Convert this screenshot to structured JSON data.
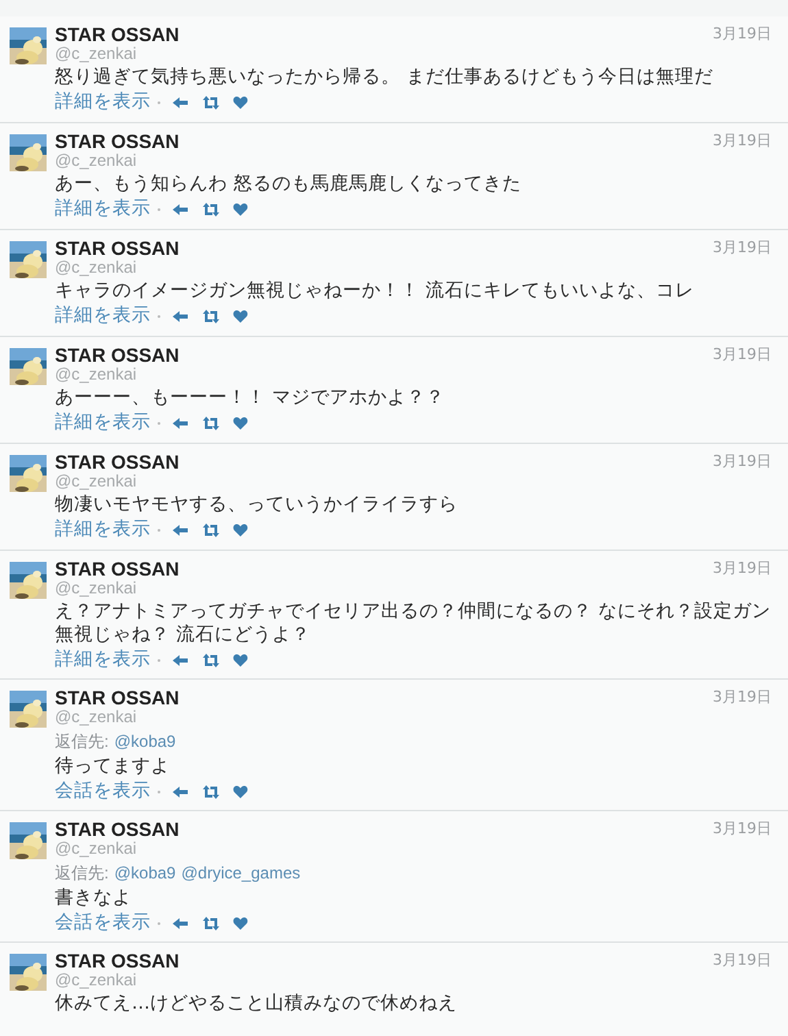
{
  "tweets": [
    {
      "name": "STAR OSSAN",
      "handle": "@c_zenkai",
      "date": "3月19日",
      "text": "怒り過ぎて気持ち悪いなったから帰る。 まだ仕事あるけどもう今日は無理だ",
      "link": "詳細を表示"
    },
    {
      "name": "STAR OSSAN",
      "handle": "@c_zenkai",
      "date": "3月19日",
      "text": "あー、もう知らんわ 怒るのも馬鹿馬鹿しくなってきた",
      "link": "詳細を表示"
    },
    {
      "name": "STAR OSSAN",
      "handle": "@c_zenkai",
      "date": "3月19日",
      "text": "キャラのイメージガン無視じゃねーか！！ 流石にキレてもいいよな、コレ",
      "link": "詳細を表示"
    },
    {
      "name": "STAR OSSAN",
      "handle": "@c_zenkai",
      "date": "3月19日",
      "text": "あーーー、もーーー！！ マジでアホかよ？？",
      "link": "詳細を表示"
    },
    {
      "name": "STAR OSSAN",
      "handle": "@c_zenkai",
      "date": "3月19日",
      "text": "物凄いモヤモヤする、っていうかイライラすら",
      "link": "詳細を表示"
    },
    {
      "name": "STAR OSSAN",
      "handle": "@c_zenkai",
      "date": "3月19日",
      "text": "え？アナトミアってガチャでイセリア出るの？仲間になるの？ なにそれ？設定ガン無視じゃね？ 流石にどうよ？",
      "link": "詳細を表示"
    },
    {
      "name": "STAR OSSAN",
      "handle": "@c_zenkai",
      "date": "3月19日",
      "reply_label": "返信先:",
      "reply_to": [
        "@koba9"
      ],
      "text": "待ってますよ",
      "link": "会話を表示"
    },
    {
      "name": "STAR OSSAN",
      "handle": "@c_zenkai",
      "date": "3月19日",
      "reply_label": "返信先:",
      "reply_to": [
        "@koba9",
        "@dryice_games"
      ],
      "text": "書きなよ",
      "link": "会話を表示"
    },
    {
      "name": "STAR OSSAN",
      "handle": "@c_zenkai",
      "date": "3月19日",
      "text": "休みてえ…けどやること山積みなので休めねえ"
    }
  ]
}
